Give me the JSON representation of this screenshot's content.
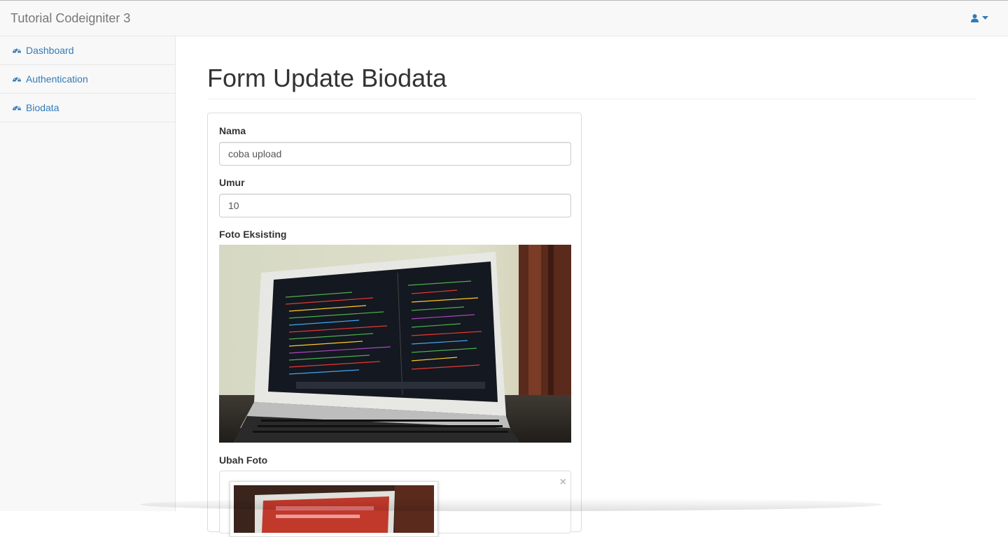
{
  "app": {
    "brand": "Tutorial Codeigniter 3"
  },
  "header": {
    "user_icon": "user-icon",
    "caret_icon": "caret-down-icon"
  },
  "sidebar": {
    "items": [
      {
        "label": "Dashboard",
        "icon": "dashboard-icon"
      },
      {
        "label": "Authentication",
        "icon": "dashboard-icon"
      },
      {
        "label": "Biodata",
        "icon": "dashboard-icon"
      }
    ]
  },
  "page": {
    "title": "Form Update Biodata"
  },
  "form": {
    "nama_label": "Nama",
    "nama_value": "coba upload",
    "umur_label": "Umur",
    "umur_value": "10",
    "foto_label": "Foto Eksisting",
    "ubah_label": "Ubah Foto",
    "remove_icon": "close-icon",
    "remove_glyph": "×"
  },
  "colors": {
    "link": "#337ab7",
    "navbar_bg": "#f8f8f8",
    "brand_text": "#777777"
  }
}
